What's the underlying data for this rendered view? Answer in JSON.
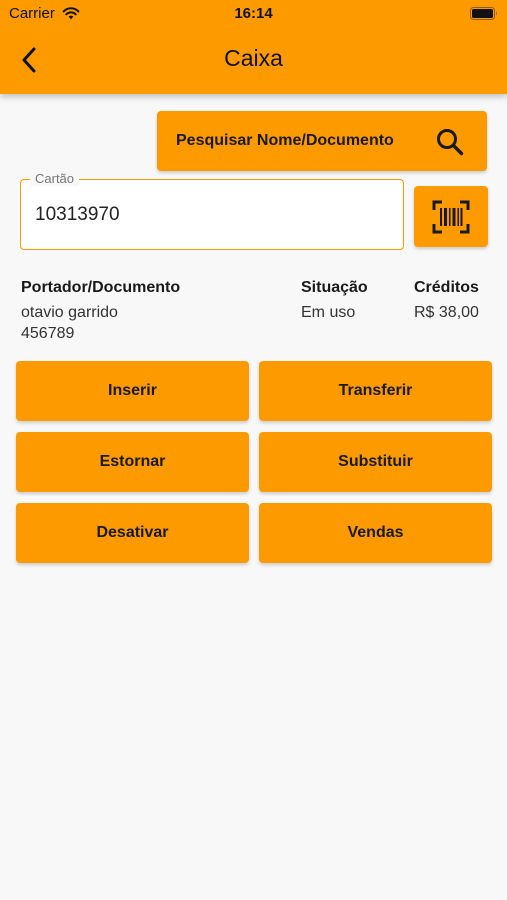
{
  "status_bar": {
    "carrier": "Carrier",
    "time": "16:14"
  },
  "header": {
    "title": "Caixa",
    "background_color": "#fd9a00"
  },
  "search": {
    "label": "Pesquisar Nome/Documento",
    "icon": "search-icon"
  },
  "card_field": {
    "label": "Cartão",
    "value": "10313970",
    "border_color": "#fd9a00"
  },
  "barcode": {
    "icon": "barcode-scan-icon"
  },
  "info": {
    "holder_heading": "Portador/Documento",
    "holder_name": "otavio garrido",
    "holder_document": "456789",
    "status_heading": "Situação",
    "status_value": "Em uso",
    "credits_heading": "Créditos",
    "credits_value": "R$ 38,00"
  },
  "actions": {
    "insert": "Inserir",
    "transfer": "Transferir",
    "reverse": "Estornar",
    "replace": "Substituir",
    "deactivate": "Desativar",
    "sales": "Vendas"
  }
}
